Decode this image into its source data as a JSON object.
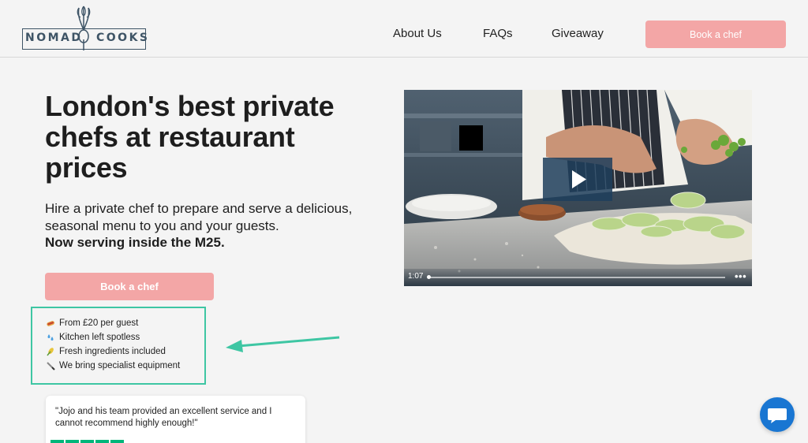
{
  "brand": {
    "logo_left": "NOMAD",
    "logo_right": "COOKS"
  },
  "nav": {
    "items": [
      {
        "label": "About Us"
      },
      {
        "label": "FAQs"
      },
      {
        "label": "Giveaway"
      }
    ],
    "cta": "Book a chef"
  },
  "hero": {
    "title": "London's best private chefs at restaurant prices",
    "subtitle": "Hire a private chef to prepare and serve a delicious, seasonal menu to you and your guests.",
    "subtitle_bold": "Now serving inside the M25.",
    "cta": "Book a chef"
  },
  "benefits": [
    {
      "icon": "hotdog-icon",
      "text": "From £20 per guest"
    },
    {
      "icon": "sweat-droplets-icon",
      "text": "Kitchen left spotless"
    },
    {
      "icon": "corn-icon",
      "text": "Fresh ingredients included"
    },
    {
      "icon": "knife-icon",
      "text": "We bring specialist equipment"
    }
  ],
  "testimonial": {
    "quote": "\"Jojo and his team provided an excellent service and I cannot recommend highly enough!\"",
    "rating": 5
  },
  "video": {
    "duration": "1:07",
    "progress": 0
  },
  "colors": {
    "accent_pink": "#f3a6a6",
    "highlight_teal": "#3ec6a3",
    "chat_blue": "#1976d2",
    "trustpilot_green": "#00b67a",
    "logo_navy": "#3e5466"
  }
}
